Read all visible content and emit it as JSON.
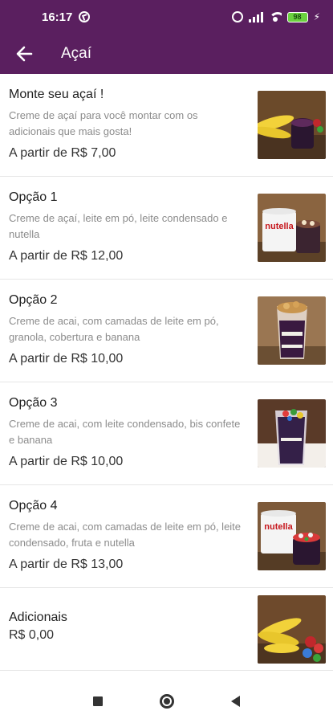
{
  "status_bar": {
    "time": "16:17",
    "battery_level": "98"
  },
  "app_bar": {
    "title": "Açaí"
  },
  "products": [
    {
      "name": "Monte seu açaí !",
      "description": "Creme de açaí para você montar com os adicionais que mais gosta!",
      "price": "A partir de R$ 7,00"
    },
    {
      "name": "Opção 1",
      "description": "Creme de açaí, leite em pó, leite condensado e nutella",
      "price": "A partir de R$ 12,00"
    },
    {
      "name": "Opção  2",
      "description": "Creme de acai, com camadas de leite em pó, granola, cobertura e banana",
      "price": "A partir de R$ 10,00"
    },
    {
      "name": "Opção 3",
      "description": "Creme de acai, com leite condensado, bis confete e banana",
      "price": "A partir de R$ 10,00"
    },
    {
      "name": "Opção 4",
      "description": "Creme de acai, com camadas de leite em pó, leite condensado, fruta e nutella",
      "price": "A partir de R$ 13,00"
    },
    {
      "name": "Adicionais",
      "price": "R$ 0,00"
    }
  ],
  "thumb_labels": {
    "nutella": "nutella"
  },
  "colors": {
    "primary": "#5a1f5f",
    "battery": "#6bd13f",
    "text_secondary": "#8c8c8c"
  },
  "icons": {
    "back": "arrow-left-icon",
    "nav_recent": "square-icon",
    "nav_home": "circle-icon",
    "nav_back": "triangle-back-icon"
  }
}
